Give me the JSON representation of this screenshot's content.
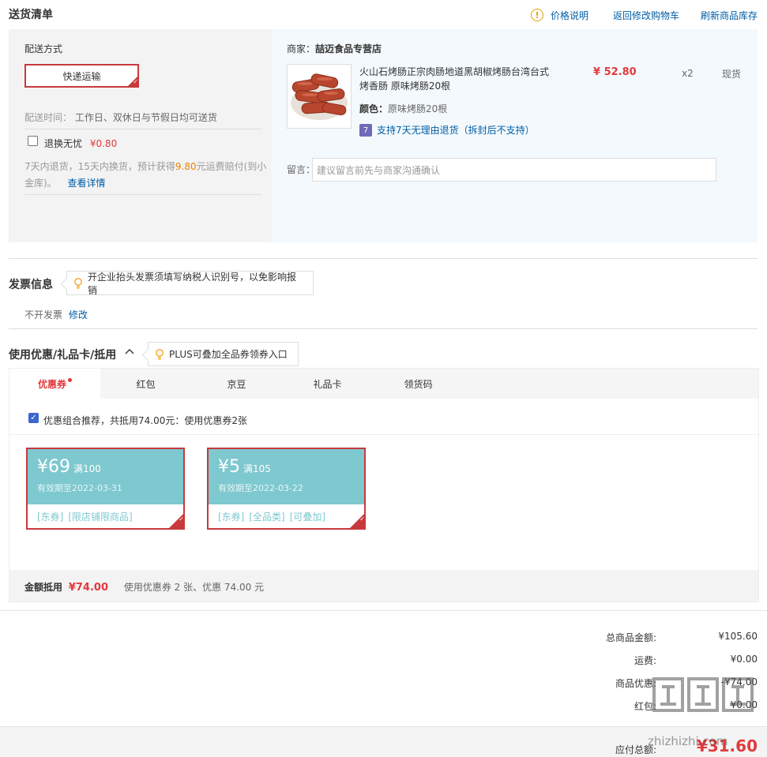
{
  "header": {
    "title": "送货清单",
    "price_info": "价格说明",
    "back_cart": "返回修改购物车",
    "refresh_stock": "刷新商品库存"
  },
  "delivery": {
    "method_label": "配送方式",
    "method_value": "快递运输",
    "time_label": "配送时间：",
    "time_value": "工作日、双休日与节假日均可送货",
    "worry_free_label": "退换无忧",
    "worry_free_price": "¥0.80",
    "desc_part1": "7天内退货，15天内换货，预计获得",
    "desc_amount": "9.80",
    "desc_part2": "元运费赔付(到小",
    "desc_part3": "金库)。",
    "details_link": "查看详情"
  },
  "shop": {
    "merchant_label": "商家：",
    "merchant_name": "喆迈食品专营店",
    "product_name_line1": "火山石烤肠正宗肉肠地道黑胡椒烤肠台湾台式",
    "product_name_line2": "烤香肠 原味烤肠20根",
    "price": "¥ 52.80",
    "quantity": "x2",
    "stock_status": "现货",
    "color_label": "颜色：",
    "color_value": "原味烤肠20根",
    "return_tag": "7",
    "return_policy": "支持7天无理由退货（拆封后不支持）",
    "message_label": "留言：",
    "message_placeholder": "建议留言前先与商家沟通确认"
  },
  "invoice": {
    "title": "发票信息",
    "tip": "开企业抬头发票须填写纳税人识别号，以免影响报销",
    "status": "不开发票",
    "modify": "修改"
  },
  "discount": {
    "title": "使用优惠/礼品卡/抵用",
    "tip": "PLUS可叠加全品券领券入口",
    "tabs": [
      "优惠券",
      "红包",
      "京豆",
      "礼品卡",
      "领货码"
    ],
    "recommend_text": "优惠组合推荐，共抵用74.00元：使用优惠券2张",
    "coupons": [
      {
        "amount": "¥69",
        "condition": "满100",
        "expiry": "有效期至2022-03-31",
        "tags": [
          "[东券]",
          "[限店铺限商品]"
        ]
      },
      {
        "amount": "¥5",
        "condition": "满105",
        "expiry": "有效期至2022-03-22",
        "tags": [
          "[东券]",
          "[全品类]",
          "[可叠加]"
        ]
      }
    ],
    "summary_label": "金额抵用",
    "summary_amount": "¥74.00",
    "summary_text": "使用优惠券 2 张、优惠 74.00 元"
  },
  "totals": {
    "rows": [
      {
        "label": "总商品金额:",
        "value": "¥105.60"
      },
      {
        "label": "运费:",
        "value": "¥0.00"
      },
      {
        "label": "商品优惠:",
        "value": "-¥74.00"
      },
      {
        "label": "红包:",
        "value": "¥0.00"
      }
    ],
    "payable_label": "应付总额:",
    "payable_value": "¥31.60"
  },
  "watermark": "zhizhizhi.com",
  "colors": {
    "accent_red": "#e4393c",
    "link_blue": "#005ea7",
    "coupon_teal": "#7ec8cf"
  }
}
